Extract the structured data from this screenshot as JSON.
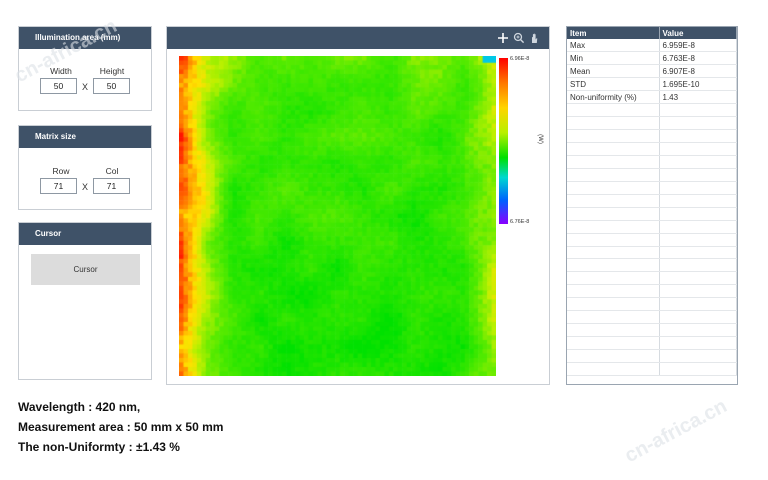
{
  "illumination": {
    "title": "Illumination area (mm)",
    "width_label": "Width",
    "height_label": "Height",
    "width_value": "50",
    "height_value": "50",
    "x_symbol": "X"
  },
  "matrix": {
    "title": "Matrix size",
    "row_label": "Row",
    "col_label": "Col",
    "row_value": "71",
    "col_value": "71",
    "x_symbol": "X"
  },
  "cursor": {
    "title": "Cursor",
    "button_label": "Cursor"
  },
  "toolbar": {
    "icons": [
      "crosshair-icon",
      "zoom-icon",
      "pan-hand-icon"
    ]
  },
  "colorbar": {
    "max_label": "6.96E-8",
    "min_label": "6.76E-8",
    "unit": "(W)"
  },
  "stats": {
    "header_item": "Item",
    "header_value": "Value",
    "rows": [
      {
        "item": "Max",
        "value": "6.959E-8"
      },
      {
        "item": "Min",
        "value": "6.763E-8"
      },
      {
        "item": "Mean",
        "value": "6.907E-8"
      },
      {
        "item": "STD",
        "value": "1.695E-10"
      },
      {
        "item": "Non-uniformity (%)",
        "value": "1.43"
      }
    ],
    "empty_rows": 21
  },
  "summary": {
    "wavelength": "Wavelength : 420 nm,",
    "area": "Measurement area : 50 mm x 50 mm",
    "nonuniformity": "The non-Uniformty :  ±1.43 %"
  },
  "watermarks": [
    "cn-africa.cn",
    "cn-africa.cn"
  ],
  "colors": {
    "header_bg": "#3f5268",
    "button_bg": "#dcdcdc",
    "heat_high": "#ff0000",
    "heat_mid": "#ffd400",
    "heat_low": "#00e000"
  }
}
